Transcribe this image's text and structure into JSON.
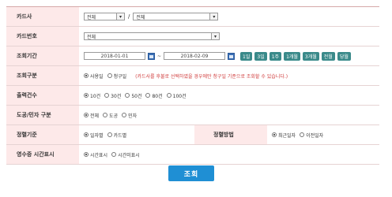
{
  "form": {
    "card_company": {
      "label": "카드사",
      "select1": "전체",
      "separator": "/",
      "select2": "전체"
    },
    "card_number": {
      "label": "카드번호",
      "select": "전체"
    },
    "period": {
      "label": "조회기간",
      "start_date": "2018-01-01",
      "tilde": "~",
      "end_date": "2018-02-09",
      "buttons": [
        "1일",
        "3일",
        "1주",
        "1개월",
        "3개월",
        "전월",
        "당월"
      ]
    },
    "search_type": {
      "label": "조회구분",
      "options": [
        "사용일",
        "청구일"
      ],
      "selected": "사용일",
      "notice": "(카드사를 후불로 선택하였을 경우에만 청구일 기준으로 조회할 수 있습니다.)"
    },
    "count": {
      "label": "출력건수",
      "options": [
        "10건",
        "30건",
        "50건",
        "80건",
        "100건"
      ],
      "selected": "10건"
    },
    "type": {
      "label": "도공/민자 구분",
      "options": [
        "전체",
        "도공",
        "민자"
      ],
      "selected": "전체"
    },
    "arrange": {
      "label": "정렬기준",
      "options": [
        "일자별",
        "카드별"
      ],
      "selected": "일자별"
    },
    "sort_method": {
      "label": "정렬방법",
      "options": [
        "최근일자",
        "이전일자"
      ],
      "selected": "최근일자"
    },
    "receipt": {
      "label": "영수증 시간표시",
      "options": [
        "시간표시",
        "시간미표시"
      ],
      "selected": "시간표시"
    }
  },
  "search_button": "조회"
}
